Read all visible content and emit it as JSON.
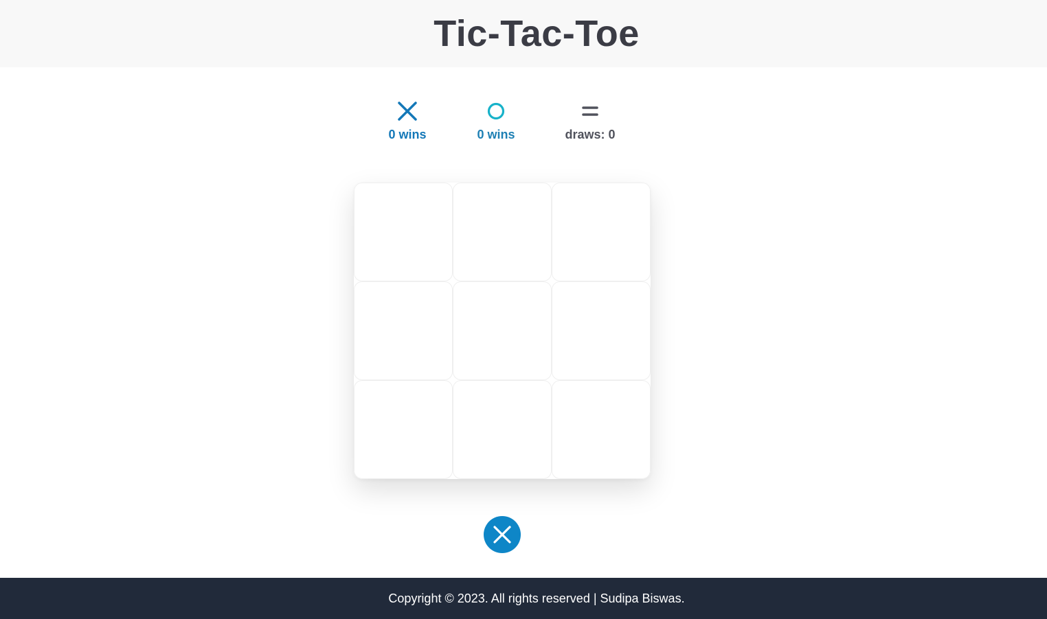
{
  "header": {
    "title": "Tic-Tac-Toe"
  },
  "scoreboard": {
    "x": {
      "icon": "x-mark-icon",
      "label": "0 wins",
      "color": "#1478b8"
    },
    "o": {
      "icon": "o-mark-icon",
      "label": "0 wins",
      "color": "#17b2c9"
    },
    "draws": {
      "icon": "equals-icon",
      "label": "draws: 0",
      "color": "#50525c"
    }
  },
  "board": {
    "cells": [
      "",
      "",
      "",
      "",
      "",
      "",
      "",
      "",
      ""
    ]
  },
  "turn": {
    "icon": "x-mark-icon",
    "current_player": "X",
    "color": "#0e86c7"
  },
  "footer": {
    "text": "Copyright © 2023. All rights reserved | Sudipa Biswas."
  }
}
